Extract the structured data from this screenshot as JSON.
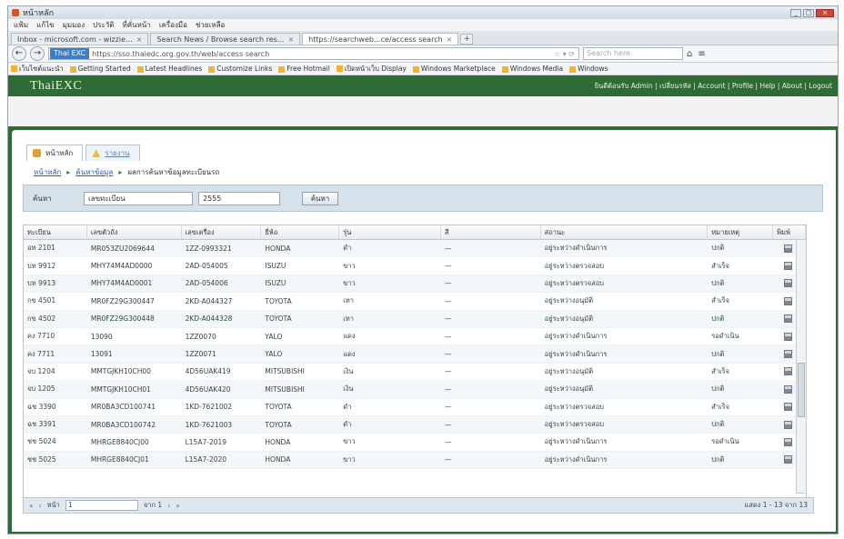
{
  "window": {
    "title": "หน้าหลัก"
  },
  "menubar": [
    "แฟ้ม",
    "แก้ไข",
    "มุมมอง",
    "ประวัติ",
    "ที่คั่นหน้า",
    "เครื่องมือ",
    "ช่วยเหลือ"
  ],
  "browser_tabs": [
    {
      "label": "Inbox - microsoft.com - wizzie...",
      "close": "×"
    },
    {
      "label": "Search News / Browse search res...",
      "close": "×"
    },
    {
      "label": "https://searchweb...ce/access search",
      "close": "×"
    }
  ],
  "newtab_label": "+",
  "address": {
    "site_label": "Thai EXC",
    "url": "https://sso.thaiedc.org.gov.th/web/access search",
    "search_placeholder": "Search here"
  },
  "nav_icons": {
    "back": "←",
    "forward": "→",
    "home": "⌂",
    "more": "≡"
  },
  "bookmarks": [
    "เว็บไซต์แนะนำ",
    "Getting Started",
    "Latest Headlines",
    "Customize Links",
    "Free Hotmail",
    "เปิดหน้าเว็บ Display",
    "Windows Marketplace",
    "Windows Media",
    "Windows"
  ],
  "app": {
    "logo": "ThaiEXC",
    "toplinks": "ยินดีต้อนรับ Admin | เปลี่ยนรหัส | Account | Profile | Help | About | Logout"
  },
  "module_tabs": [
    {
      "label": "หน้าหลัก"
    },
    {
      "label": "รายงาน"
    }
  ],
  "breadcrumb": {
    "home": "หน้าหลัก",
    "section": "ค้นหาข้อมูล",
    "current": "ผลการค้นหาข้อมูลทะเบียนรถ",
    "sep": "▸"
  },
  "filter": {
    "label": "ค้นหา",
    "field1_value": "เลขทะเบียน",
    "field2_value": "2555",
    "button": "ค้นหา"
  },
  "grid": {
    "columns": [
      "ทะเบียน",
      "เลขตัวถัง",
      "เลขเครื่อง",
      "ยี่ห้อ",
      "รุ่น",
      "สี",
      "สถานะ",
      "หมายเหตุ",
      "พิมพ์"
    ],
    "rows": [
      [
        "อท 2101",
        "MR053ZU2069644",
        "1ZZ-0993321",
        "HONDA",
        "ดำ",
        "—",
        "อยู่ระหว่างดำเนินการ",
        "ปกติ"
      ],
      [
        "บท 9912",
        "MHY74M4AD0000",
        "2AD-054005",
        "ISUZU",
        "ขาว",
        "—",
        "อยู่ระหว่างตรวจสอบ",
        "สำเร็จ"
      ],
      [
        "บท 9913",
        "MHY74M4AD0001",
        "2AD-054006",
        "ISUZU",
        "ขาว",
        "—",
        "อยู่ระหว่างตรวจสอบ",
        "ปกติ"
      ],
      [
        "กข 4501",
        "MR0FZ29G300447",
        "2KD-A044327",
        "TOYOTA",
        "เทา",
        "—",
        "อยู่ระหว่างอนุมัติ",
        "สำเร็จ"
      ],
      [
        "กข 4502",
        "MR0FZ29G300448",
        "2KD-A044328",
        "TOYOTA",
        "เทา",
        "—",
        "อยู่ระหว่างอนุมัติ",
        "ปกติ"
      ],
      [
        "คง 7710",
        "13090",
        "1ZZ0070",
        "YALO",
        "แดง",
        "—",
        "อยู่ระหว่างดำเนินการ",
        "รอดำเนิน"
      ],
      [
        "คง 7711",
        "13091",
        "1ZZ0071",
        "YALO",
        "แดง",
        "—",
        "อยู่ระหว่างดำเนินการ",
        "ปกติ"
      ],
      [
        "จบ 1204",
        "MMTGJKH10CH00",
        "4D56UAK419",
        "MITSUBISHI",
        "เงิน",
        "—",
        "อยู่ระหว่างอนุมัติ",
        "สำเร็จ"
      ],
      [
        "จบ 1205",
        "MMTGJKH10CH01",
        "4D56UAK420",
        "MITSUBISHI",
        "เงิน",
        "—",
        "อยู่ระหว่างอนุมัติ",
        "ปกติ"
      ],
      [
        "ฉช 3390",
        "MR0BA3CD100741",
        "1KD-7621002",
        "TOYOTA",
        "ดำ",
        "—",
        "อยู่ระหว่างตรวจสอบ",
        "สำเร็จ"
      ],
      [
        "ฉช 3391",
        "MR0BA3CD100742",
        "1KD-7621003",
        "TOYOTA",
        "ดำ",
        "—",
        "อยู่ระหว่างตรวจสอบ",
        "ปกติ"
      ],
      [
        "ชช 5024",
        "MHRGE8840CJ00",
        "L15A7-2019",
        "HONDA",
        "ขาว",
        "—",
        "อยู่ระหว่างดำเนินการ",
        "รอดำเนิน"
      ],
      [
        "ชช 5025",
        "MHRGE8840CJ01",
        "L15A7-2020",
        "HONDA",
        "ขาว",
        "—",
        "อยู่ระหว่างดำเนินการ",
        "ปกติ"
      ]
    ]
  },
  "pager": {
    "first": "«",
    "prev": "‹",
    "page_label": "หน้า",
    "page_value": "1",
    "of_text": "จาก 1",
    "next": "›",
    "last": "»",
    "info": "แสดง 1 - 13 จาก 13"
  }
}
